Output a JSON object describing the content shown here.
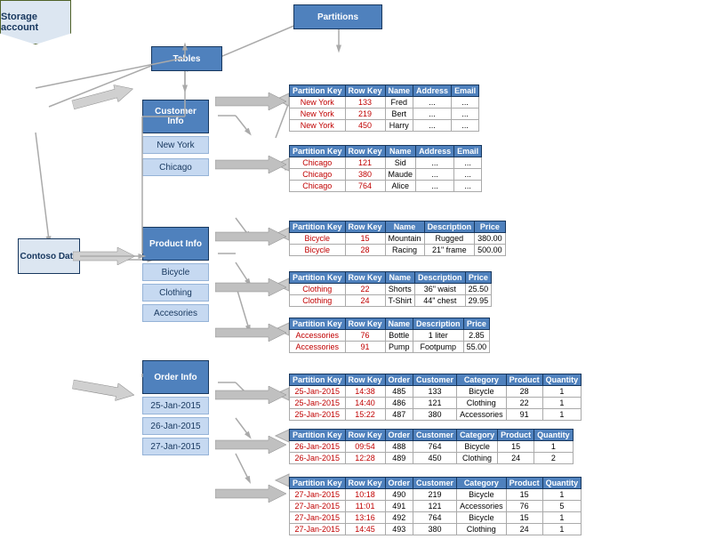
{
  "labels": {
    "partitions": "Partitions",
    "tables": "Tables",
    "storage_account": "Storage account",
    "contoso_data": "Contoso Data"
  },
  "groups": [
    {
      "name": "Customer Info",
      "partitions": [
        "New York",
        "Chicago"
      ],
      "tables": [
        {
          "partition_key": [
            "New York",
            "New York",
            "New York"
          ],
          "row_key": [
            "133",
            "219",
            "450"
          ],
          "name": [
            "Fred",
            "Bert",
            "Harry"
          ],
          "col4_header": "Address",
          "col4": [
            "...",
            "...",
            "..."
          ],
          "col5_header": "Email",
          "col5": [
            "...",
            "...",
            "..."
          ]
        },
        {
          "partition_key": [
            "Chicago",
            "Chicago",
            "Chicago"
          ],
          "row_key": [
            "121",
            "380",
            "764"
          ],
          "name": [
            "Sid",
            "Maude",
            "Alice"
          ],
          "col4_header": "Address",
          "col4": [
            "...",
            "...",
            "..."
          ],
          "col5_header": "Email",
          "col5": [
            "...",
            "...",
            "..."
          ]
        }
      ]
    },
    {
      "name": "Product Info",
      "partitions": [
        "Bicycle",
        "Clothing",
        "Accesories"
      ],
      "tables": [
        {
          "partition_key": [
            "Bicycle",
            "Bicycle"
          ],
          "row_key": [
            "15",
            "28"
          ],
          "name": [
            "Mountain",
            "Racing"
          ],
          "col4_header": "Description",
          "col4": [
            "Rugged",
            "21\" frame"
          ],
          "col5_header": "Price",
          "col5": [
            "380.00",
            "500.00"
          ]
        },
        {
          "partition_key": [
            "Clothing",
            "Clothing"
          ],
          "row_key": [
            "22",
            "24"
          ],
          "name": [
            "Shorts",
            "T-Shirt"
          ],
          "col4_header": "Description",
          "col4": [
            "36\" waist",
            "44\" chest"
          ],
          "col5_header": "Price",
          "col5": [
            "25.50",
            "29.95"
          ]
        },
        {
          "partition_key": [
            "Accessories",
            "Accessories"
          ],
          "row_key": [
            "76",
            "91"
          ],
          "name": [
            "Bottle",
            "Pump"
          ],
          "col4_header": "Description",
          "col4": [
            "1 liter",
            "Footpump"
          ],
          "col5_header": "Price",
          "col5": [
            "2.85",
            "55.00"
          ]
        }
      ]
    },
    {
      "name": "Order Info",
      "partitions": [
        "25-Jan-2015",
        "26-Jan-2015",
        "27-Jan-2015"
      ],
      "tables": [
        {
          "partition_key": [
            "25-Jan-2015",
            "25-Jan-2015",
            "25-Jan-2015"
          ],
          "row_key": [
            "14:38",
            "14:40",
            "15:22"
          ],
          "col3_header": "Order",
          "col3": [
            "485",
            "486",
            "487"
          ],
          "col4_header": "Customer",
          "col4": [
            "133",
            "121",
            "380"
          ],
          "col5_header": "Category",
          "col5": [
            "Bicycle",
            "Clothing",
            "Accessories"
          ],
          "col6_header": "Product",
          "col6": [
            "28",
            "22",
            "91"
          ],
          "col7_header": "Quantity",
          "col7": [
            "1",
            "1",
            "1"
          ]
        },
        {
          "partition_key": [
            "26-Jan-2015",
            "26-Jan-2015"
          ],
          "row_key": [
            "09:54",
            "12:28"
          ],
          "col3_header": "Order",
          "col3": [
            "488",
            "489"
          ],
          "col4_header": "Customer",
          "col4": [
            "764",
            "450"
          ],
          "col5_header": "Category",
          "col5": [
            "Bicycle",
            "Clothing"
          ],
          "col6_header": "Product",
          "col6": [
            "15",
            "24"
          ],
          "col7_header": "Quantity",
          "col7": [
            "1",
            "2"
          ]
        },
        {
          "partition_key": [
            "27-Jan-2015",
            "27-Jan-2015",
            "27-Jan-2015",
            "27-Jan-2015"
          ],
          "row_key": [
            "10:18",
            "11:01",
            "13:16",
            "14:45"
          ],
          "col3_header": "Order",
          "col3": [
            "490",
            "491",
            "492",
            "493"
          ],
          "col4_header": "Customer",
          "col4": [
            "219",
            "121",
            "764",
            "380"
          ],
          "col5_header": "Category",
          "col5": [
            "Bicycle",
            "Accessories",
            "Bicycle",
            "Clothing"
          ],
          "col6_header": "Product",
          "col6": [
            "15",
            "76",
            "15",
            "24"
          ],
          "col7_header": "Quantity",
          "col7": [
            "1",
            "5",
            "1",
            "1"
          ]
        }
      ]
    }
  ]
}
